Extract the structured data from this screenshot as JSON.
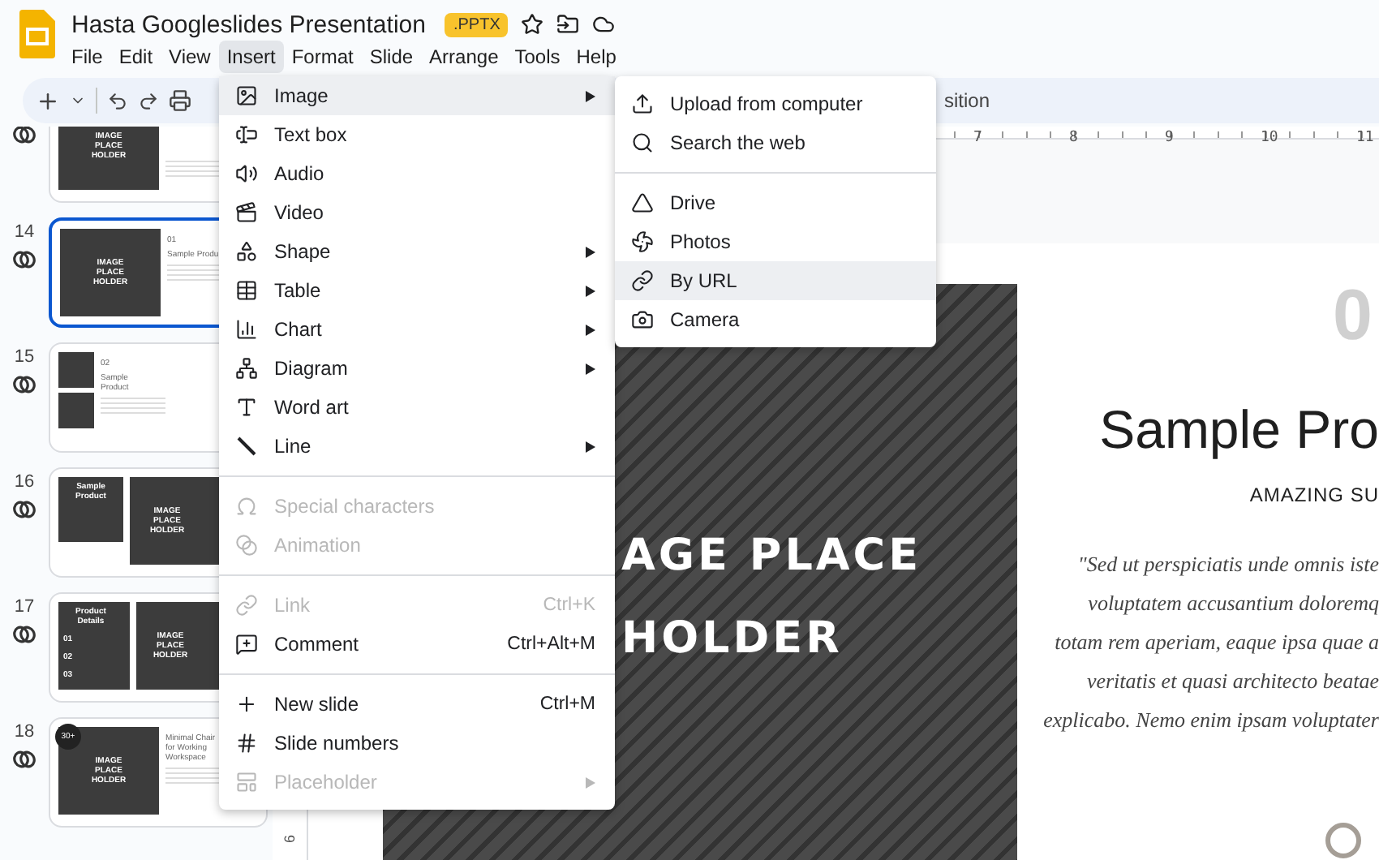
{
  "document": {
    "title": "Hasta Googleslides Presentation",
    "badge": ".PPTX"
  },
  "menu_bar": [
    {
      "label": "File",
      "selected": false
    },
    {
      "label": "Edit",
      "selected": false
    },
    {
      "label": "View",
      "selected": false
    },
    {
      "label": "Insert",
      "selected": true
    },
    {
      "label": "Format",
      "selected": false
    },
    {
      "label": "Slide",
      "selected": false
    },
    {
      "label": "Arrange",
      "selected": false
    },
    {
      "label": "Tools",
      "selected": false
    },
    {
      "label": "Help",
      "selected": false
    }
  ],
  "toolbar": {
    "visible_label": "sition"
  },
  "filmstrip": [
    {
      "selected": false,
      "kind": "image-left",
      "image_text": "IMAGE PLACE HOLDER"
    },
    {
      "number": "14",
      "selected": true,
      "kind": "image-left",
      "image_text": "IMAGE PLACE HOLDER",
      "index_text": "01",
      "heading": "Sample Produ"
    },
    {
      "number": "15",
      "selected": false,
      "kind": "two-images",
      "index_text": "02",
      "heading": "Sample Product"
    },
    {
      "number": "16",
      "selected": false,
      "kind": "overlap",
      "image_text": "IMAGE PLACE HOLDER",
      "heading": "Sample Product"
    },
    {
      "number": "17",
      "selected": false,
      "kind": "details",
      "image_text": "IMAGE PLACE HOLDER",
      "heading": "Product Details",
      "rows": [
        "01",
        "02",
        "03"
      ]
    },
    {
      "number": "18",
      "selected": false,
      "kind": "image-left",
      "image_text": "IMAGE PLACE HOLDER",
      "badge": "30+",
      "heading": "Minimal Chair for Working Workspace"
    }
  ],
  "ruler": {
    "ticks": [
      "7",
      "8",
      "9",
      "10",
      "11"
    ],
    "vertical_label": "6"
  },
  "slide": {
    "image_lines": [
      "AGE PLACE",
      "HOLDER"
    ],
    "number": "0",
    "title": "Sample Pro",
    "subtitle": "AMAZING SU",
    "quote_lines": [
      "\"Sed ut perspiciatis unde omnis iste",
      "voluptatem accusantium doloremq",
      "totam rem aperiam, eaque ipsa quae a",
      "veritatis et quasi architecto beatae",
      "explicabo. Nemo enim ipsam voluptater"
    ]
  },
  "insert_menu": [
    {
      "kind": "item",
      "label": "Image",
      "selected": true,
      "disabled": false,
      "submenu": true
    },
    {
      "kind": "item",
      "label": "Text box",
      "selected": false,
      "disabled": false,
      "submenu": false
    },
    {
      "kind": "item",
      "label": "Audio",
      "selected": false,
      "disabled": false,
      "submenu": false
    },
    {
      "kind": "item",
      "label": "Video",
      "selected": false,
      "disabled": false,
      "submenu": false
    },
    {
      "kind": "item",
      "label": "Shape",
      "selected": false,
      "disabled": false,
      "submenu": true
    },
    {
      "kind": "item",
      "label": "Table",
      "selected": false,
      "disabled": false,
      "submenu": true
    },
    {
      "kind": "item",
      "label": "Chart",
      "selected": false,
      "disabled": false,
      "submenu": true
    },
    {
      "kind": "item",
      "label": "Diagram",
      "selected": false,
      "disabled": false,
      "submenu": true
    },
    {
      "kind": "item",
      "label": "Word art",
      "selected": false,
      "disabled": false,
      "submenu": false
    },
    {
      "kind": "item",
      "label": "Line",
      "selected": false,
      "disabled": false,
      "submenu": true
    },
    {
      "kind": "separator"
    },
    {
      "kind": "item",
      "label": "Special characters",
      "selected": false,
      "disabled": true,
      "submenu": false
    },
    {
      "kind": "item",
      "label": "Animation",
      "selected": false,
      "disabled": true,
      "submenu": false
    },
    {
      "kind": "separator"
    },
    {
      "kind": "item",
      "label": "Link",
      "selected": false,
      "disabled": true,
      "submenu": false,
      "shortcut": "Ctrl+K"
    },
    {
      "kind": "item",
      "label": "Comment",
      "selected": false,
      "disabled": false,
      "submenu": false,
      "shortcut": "Ctrl+Alt+M"
    },
    {
      "kind": "separator"
    },
    {
      "kind": "item",
      "label": "New slide",
      "selected": false,
      "disabled": false,
      "submenu": false,
      "shortcut": "Ctrl+M"
    },
    {
      "kind": "item",
      "label": "Slide numbers",
      "selected": false,
      "disabled": false,
      "submenu": false
    },
    {
      "kind": "item",
      "label": "Placeholder",
      "selected": false,
      "disabled": true,
      "submenu": true
    }
  ],
  "image_submenu": [
    {
      "kind": "item",
      "label": "Upload from computer",
      "selected": false
    },
    {
      "kind": "item",
      "label": "Search the web",
      "selected": false
    },
    {
      "kind": "separator"
    },
    {
      "kind": "item",
      "label": "Drive",
      "selected": false
    },
    {
      "kind": "item",
      "label": "Photos",
      "selected": false
    },
    {
      "kind": "item",
      "label": "By URL",
      "selected": true
    },
    {
      "kind": "item",
      "label": "Camera",
      "selected": false
    }
  ]
}
